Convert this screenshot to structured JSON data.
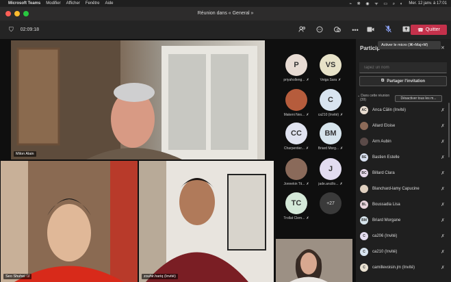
{
  "menubar": {
    "app_name": "Microsoft Teams",
    "items": [
      "Modifier",
      "Afficher",
      "Fenêtre",
      "Aide"
    ],
    "datetime": "Mer. 12 janv. à 17:01"
  },
  "window": {
    "title": "Réunion dans « General »"
  },
  "toolbar": {
    "timer": "02:09:18",
    "leave_label": "Quitter"
  },
  "tooltip": {
    "text": "Activer le micro (⌘+Maj+M)"
  },
  "stage": {
    "tiles": [
      {
        "name": "Milon Alain"
      },
      {
        "name": "Seo Shuhei"
      },
      {
        "name": "zouhir.hariq (Invité)"
      }
    ]
  },
  "roster": [
    {
      "initials": "P",
      "name": "priyaholleng...",
      "color": "#e8dcd4"
    },
    {
      "initials": "VS",
      "name": "Veiga Sara",
      "color": "#e7e2c8"
    },
    {
      "initials": "",
      "name": "Makeni Nes...",
      "color": "#b65c3c"
    },
    {
      "initials": "C",
      "name": "ca210 (Invité)",
      "color": "#d8e4f0"
    },
    {
      "initials": "CC",
      "name": "Charpentier...",
      "color": "#e0e3f0"
    },
    {
      "initials": "BM",
      "name": "Briard Morg...",
      "color": "#d6e4ec"
    },
    {
      "initials": "",
      "name": "Jonnekin Tit...",
      "color": "#8a6a5a"
    },
    {
      "initials": "J",
      "name": "jade.ancillo...",
      "color": "#e2dcf0"
    },
    {
      "initials": "TC",
      "name": "Trollat Clem...",
      "color": "#d4e8d8"
    },
    {
      "initials": "+27",
      "name": "",
      "color": "#3a3a3a"
    }
  ],
  "panel": {
    "title": "Particip",
    "search_placeholder": "Tapez un nom",
    "share_label": "Partager l'invitation",
    "section_label": "Dans cette réunion (39)",
    "mute_all_label": "Désactiver tous les m...",
    "participants": [
      {
        "initials": "AC",
        "name": "Anca Călin (Invité)",
        "color": "#e8dcd0"
      },
      {
        "initials": "",
        "name": "Allard Eloise",
        "color": "#8c6a58"
      },
      {
        "initials": "",
        "name": "Arm Aubin",
        "color": "#5a4a48"
      },
      {
        "initials": "BE",
        "name": "Bastien Estelle",
        "color": "#d8e0f0"
      },
      {
        "initials": "BC",
        "name": "Billard Clara",
        "color": "#e6d8ea"
      },
      {
        "initials": "",
        "name": "Blanchard-lamy Capucine",
        "color": "#e0d0c0"
      },
      {
        "initials": "BL",
        "name": "Boussadia Lisa",
        "color": "#e8d4dc"
      },
      {
        "initials": "BM",
        "name": "Briard Morgane",
        "color": "#d6e4ec"
      },
      {
        "initials": "C",
        "name": "ca206 (Invité)",
        "color": "#e4dcf0"
      },
      {
        "initials": "C",
        "name": "ca210 (Invité)",
        "color": "#d8e4f0"
      },
      {
        "initials": "C",
        "name": "camillevoisin.jm (Invité)",
        "color": "#e8e0d0"
      }
    ]
  }
}
